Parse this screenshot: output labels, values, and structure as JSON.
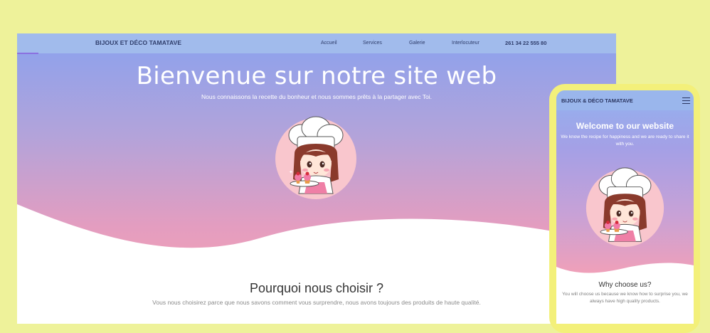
{
  "desktop": {
    "brand": "BIJOUX ET DÉCO TAMATAVE",
    "nav": [
      {
        "label": "Accueil"
      },
      {
        "label": "Services"
      },
      {
        "label": "Galerie"
      },
      {
        "label": "Interlocuteur"
      }
    ],
    "phone": "261 34 22 555 80",
    "hero": {
      "title": "Bienvenue sur notre site web",
      "subtitle": "Nous connaissons la recette du bonheur et nous sommes prêts à la partager avec Toi."
    },
    "section": {
      "title": "Pourquoi nous choisir ?",
      "text": "Vous nous choisirez parce que nous savons comment vous surprendre, nous avons toujours des produits de haute qualité."
    }
  },
  "mobile": {
    "brand": "BIJOUX & DÉCO TAMATAVE",
    "menu_icon": "hamburger-menu-icon",
    "hero": {
      "title": "Welcome to our website",
      "subtitle": "We know the recipe for happiness and we are ready to share it with you."
    },
    "section": {
      "title": "Why choose us?",
      "text": "You will choose us because we know how to surprise you, we always have high quality products."
    }
  },
  "colors": {
    "background": "#eef29a",
    "navbar": "#a1bbec",
    "gradient_top": "#8aa2ee",
    "gradient_bottom": "#f6a0b3",
    "brand_text": "#2f3d6b"
  },
  "illustration": "chef-girl-with-cupcakes"
}
